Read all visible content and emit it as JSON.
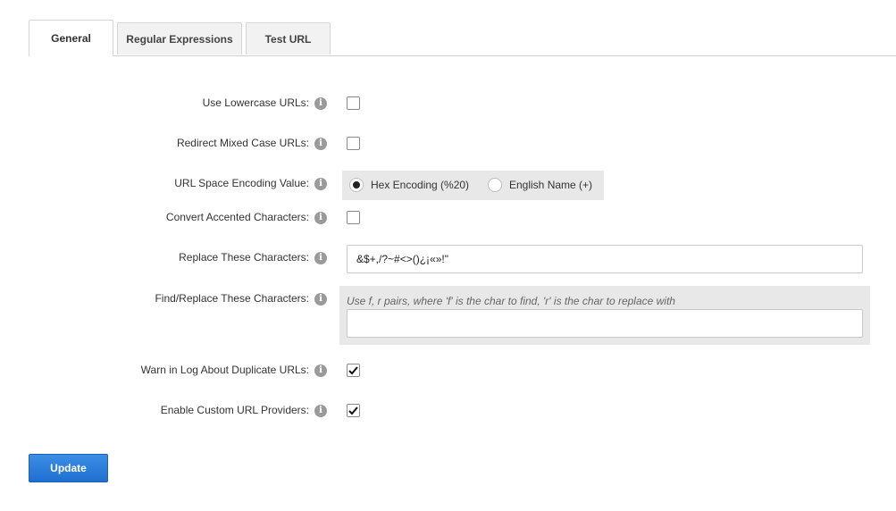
{
  "tabs": [
    {
      "label": "General",
      "active": true
    },
    {
      "label": "Regular Expressions",
      "active": false
    },
    {
      "label": "Test URL",
      "active": false
    }
  ],
  "form": {
    "use_lowercase": {
      "label": "Use Lowercase URLs:",
      "checked": false
    },
    "redirect_mixed": {
      "label": "Redirect Mixed Case URLs:",
      "checked": false
    },
    "space_encoding": {
      "label": "URL Space Encoding Value:",
      "options": [
        {
          "label": "Hex Encoding (%20)",
          "selected": true
        },
        {
          "label": "English Name (+)",
          "selected": false
        }
      ]
    },
    "convert_accented": {
      "label": "Convert Accented Characters:",
      "checked": false
    },
    "replace_chars": {
      "label": "Replace These Characters:",
      "value": "&$+,/?~#<>()¿¡«»!\""
    },
    "find_replace": {
      "label": "Find/Replace These Characters:",
      "hint": "Use f, r pairs, where 'f' is the char to find, 'r' is the char to replace with",
      "value": ""
    },
    "warn_duplicates": {
      "label": "Warn in Log About Duplicate URLs:",
      "checked": true
    },
    "custom_providers": {
      "label": "Enable Custom URL Providers:",
      "checked": true
    }
  },
  "info_icon_glyph": "i",
  "update_button": {
    "label": "Update"
  },
  "colors": {
    "accent": "#2a78da",
    "panel_bg": "#e8e8e8"
  }
}
